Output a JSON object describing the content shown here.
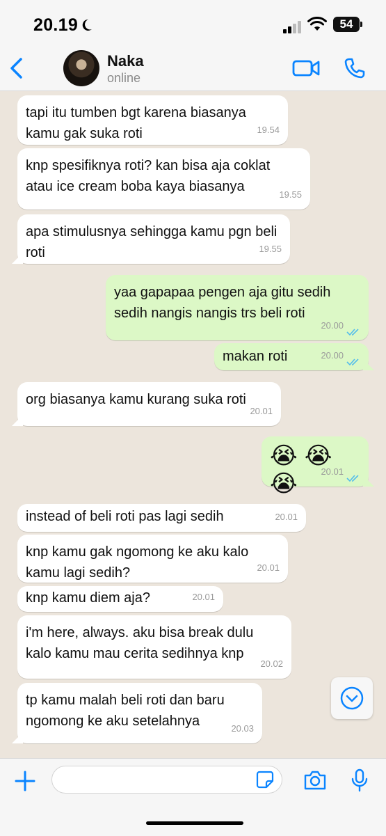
{
  "status_bar": {
    "time": "20.19",
    "battery": "54"
  },
  "header": {
    "contact_name": "Naka",
    "contact_status": "online"
  },
  "messages": [
    {
      "dir": "in",
      "text": "tapi itu tumben bgt karena biasanya kamu gak suka roti",
      "time": "19.54"
    },
    {
      "dir": "in",
      "text": "knp spesifiknya roti? kan bisa aja coklat atau ice cream boba kaya biasanya",
      "time": "19.55"
    },
    {
      "dir": "in",
      "text": "apa stimulusnya sehingga kamu pgn beli roti",
      "time": "19.55"
    },
    {
      "dir": "out",
      "text": "yaa gapapaa pengen aja gitu sedih sedih nangis nangis trs beli roti",
      "time": "20.00"
    },
    {
      "dir": "out",
      "text": "makan roti",
      "time": "20.00"
    },
    {
      "dir": "in",
      "text": "org biasanya kamu kurang suka roti",
      "time": "20.01"
    },
    {
      "dir": "out",
      "text": "😭😭😭",
      "time": "20.01"
    },
    {
      "dir": "in",
      "text": "instead of beli roti pas lagi sedih",
      "time": "20.01"
    },
    {
      "dir": "in",
      "text": "knp kamu gak ngomong ke aku kalo kamu lagi sedih?",
      "time": "20.01"
    },
    {
      "dir": "in",
      "text": "knp kamu diem aja?",
      "time": "20.01"
    },
    {
      "dir": "in",
      "text": "i'm here, always. aku bisa break dulu kalo kamu mau cerita sedihnya knp",
      "time": "20.02"
    },
    {
      "dir": "in",
      "text": "tp kamu malah beli roti dan baru ngomong ke aku setelahnya",
      "time": "20.03"
    }
  ],
  "icons": {
    "back": "chevron-left-icon",
    "video": "video-camera-icon",
    "call": "phone-icon",
    "plus": "plus-icon",
    "sticker": "sticker-icon",
    "camera": "camera-icon",
    "mic": "microphone-icon",
    "scroll": "chevron-down-icon"
  },
  "colors": {
    "accent": "#0A84FF",
    "outgoing_bubble": "#DCF8C6",
    "incoming_bubble": "#FFFFFF",
    "read_ticks": "#53BDEB",
    "chat_background": "#ECE5DC"
  }
}
